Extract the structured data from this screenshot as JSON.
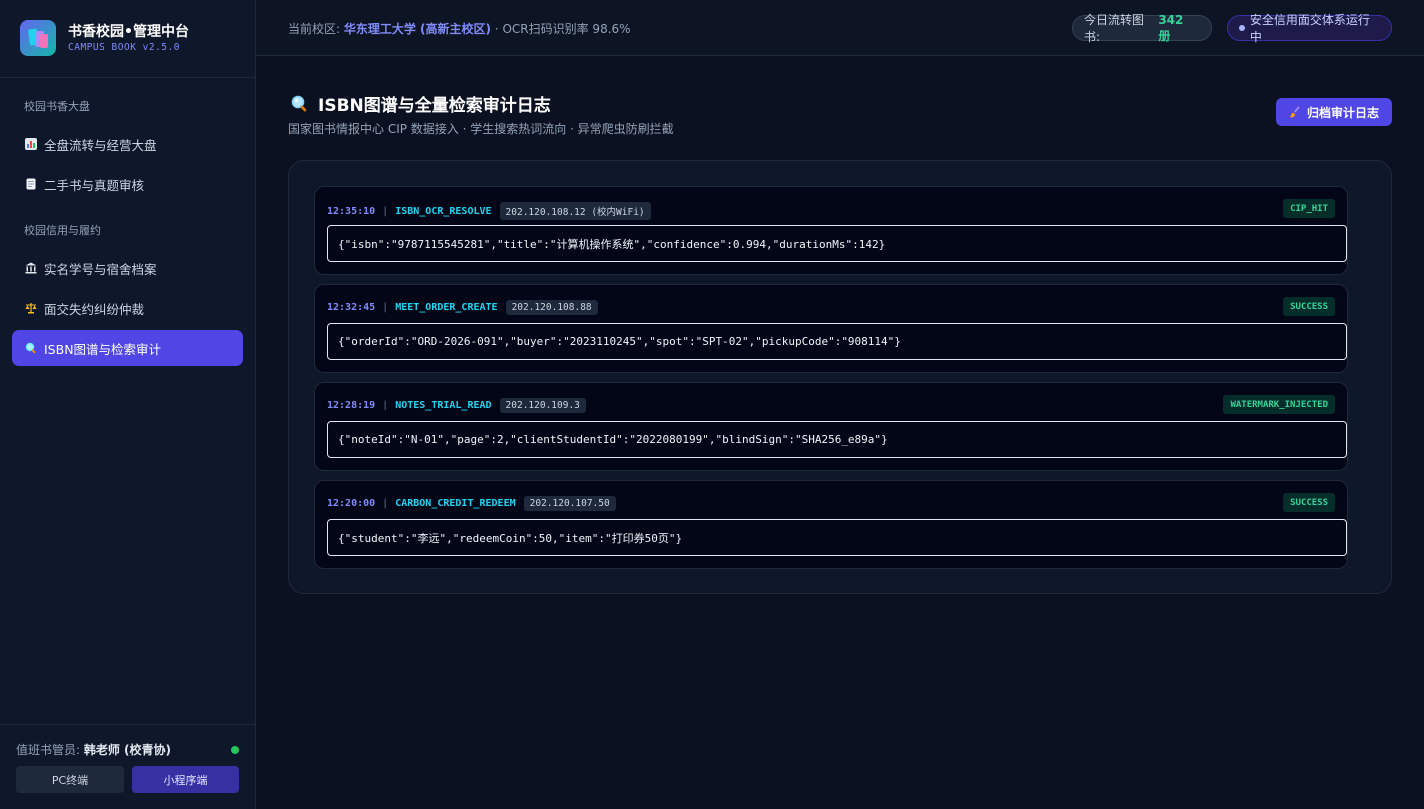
{
  "brand": {
    "title": "书香校园•管理中台",
    "subtitle": "CAMPUS BOOK v2.5.0"
  },
  "sidebar": {
    "sections": [
      {
        "label": "校园书香大盘"
      },
      {
        "label": "校园信用与履约"
      }
    ],
    "items": [
      {
        "label": "全盘流转与经营大盘",
        "icon": "bar-chart-icon"
      },
      {
        "label": "二手书与真题审核",
        "icon": "document-icon"
      },
      {
        "label": "实名学号与宿舍档案",
        "icon": "bank-icon"
      },
      {
        "label": "面交失约纠纷仲裁",
        "icon": "scales-icon"
      },
      {
        "label": "ISBN图谱与检索审计",
        "icon": "search-icon",
        "active": true
      }
    ],
    "footer": {
      "duty_prefix": "值班书管员: ",
      "duty_name": "韩老师 (校青协)",
      "pc_label": "PC终端",
      "mini_label": "小程序端"
    }
  },
  "topbar": {
    "campus_prefix": "当前校区: ",
    "campus_name": "华东理工大学 (高新主校区)",
    "ocr_text": " · OCR扫码识别率 98.6%",
    "books_label": "今日流转图书:",
    "books_count": "342 册",
    "secure_text": "安全信用面交体系运行中"
  },
  "page": {
    "title": "ISBN图谱与全量检索审计日志",
    "subtitle": "国家图书情报中心 CIP 数据接入 · 学生搜索热词流向 · 异常爬虫防刷拦截",
    "archive_label": "归档审计日志"
  },
  "logs": [
    {
      "time": "12:35:10",
      "event": "ISBN_OCR_RESOLVE",
      "ip": "202.120.108.12 (校内WiFi)",
      "status": "CIP_HIT",
      "payload": "{\"isbn\":\"9787115545281\",\"title\":\"计算机操作系统\",\"confidence\":0.994,\"durationMs\":142}"
    },
    {
      "time": "12:32:45",
      "event": "MEET_ORDER_CREATE",
      "ip": "202.120.108.88",
      "status": "SUCCESS",
      "payload": "{\"orderId\":\"ORD-2026-091\",\"buyer\":\"2023110245\",\"spot\":\"SPT-02\",\"pickupCode\":\"908114\"}"
    },
    {
      "time": "12:28:19",
      "event": "NOTES_TRIAL_READ",
      "ip": "202.120.109.3",
      "status": "WATERMARK_INJECTED",
      "payload": "{\"noteId\":\"N-01\",\"page\":2,\"clientStudentId\":\"2022080199\",\"blindSign\":\"SHA256_e89a\"}"
    },
    {
      "time": "12:20:00",
      "event": "CARBON_CREDIT_REDEEM",
      "ip": "202.120.107.50",
      "status": "SUCCESS",
      "payload": "{\"student\":\"李远\",\"redeemCoin\":50,\"item\":\"打印券50页\"}"
    }
  ],
  "colors": {
    "accent": "#4f46e5",
    "status_green": "#34d399",
    "event_cyan": "#22d3ee",
    "time_indigo": "#818cf8"
  }
}
